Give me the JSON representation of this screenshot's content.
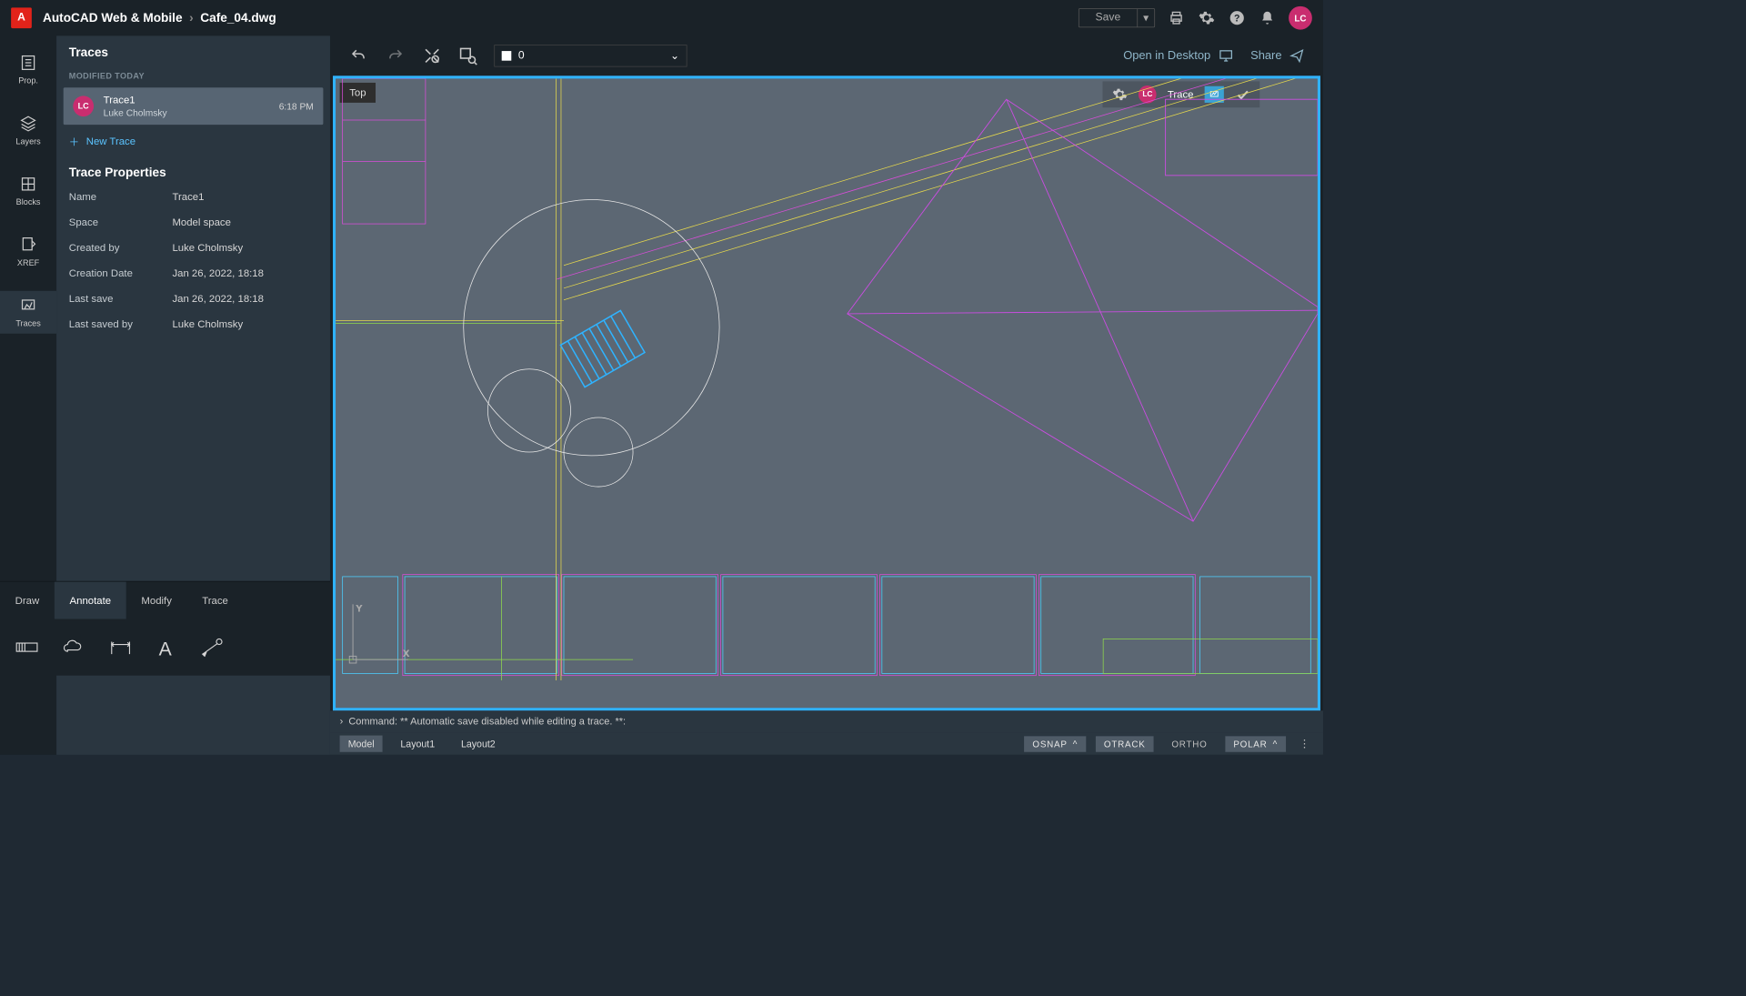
{
  "header": {
    "app_name": "AutoCAD Web & Mobile",
    "filename": "Cafe_04.dwg",
    "save_label": "Save",
    "open_desktop_label": "Open in Desktop",
    "share_label": "Share",
    "avatar_initials": "LC"
  },
  "rail": {
    "items": [
      "Prop.",
      "Layers",
      "Blocks",
      "XREF",
      "Traces"
    ],
    "active": 4
  },
  "panel": {
    "title": "Traces",
    "section": "MODIFIED TODAY",
    "trace": {
      "avatar": "LC",
      "name": "Trace1",
      "author": "Luke Cholmsky",
      "time": "6:18 PM"
    },
    "new_trace_label": "New Trace",
    "props_title": "Trace Properties",
    "props": [
      {
        "k": "Name",
        "v": "Trace1"
      },
      {
        "k": "Space",
        "v": "Model space"
      },
      {
        "k": "Created by",
        "v": "Luke Cholmsky"
      },
      {
        "k": "Creation Date",
        "v": "Jan 26, 2022, 18:18"
      },
      {
        "k": "Last save",
        "v": "Jan 26, 2022, 18:18"
      },
      {
        "k": "Last saved by",
        "v": "Luke Cholmsky"
      }
    ]
  },
  "bottom_tabs": [
    "Draw",
    "Annotate",
    "Modify",
    "Trace"
  ],
  "active_bottom_tab": 1,
  "layer_selector": {
    "name": "0"
  },
  "viewport": {
    "label": "Top",
    "trace_label": "Trace",
    "trace_avatar": "LC"
  },
  "command_line": "Command: ** Automatic save disabled while editing a trace. **:",
  "layout_tabs": [
    "Model",
    "Layout1",
    "Layout2"
  ],
  "active_layout": 0,
  "snaps": [
    "OSNAP",
    "OTRACK",
    "ORTHO",
    "POLAR"
  ]
}
